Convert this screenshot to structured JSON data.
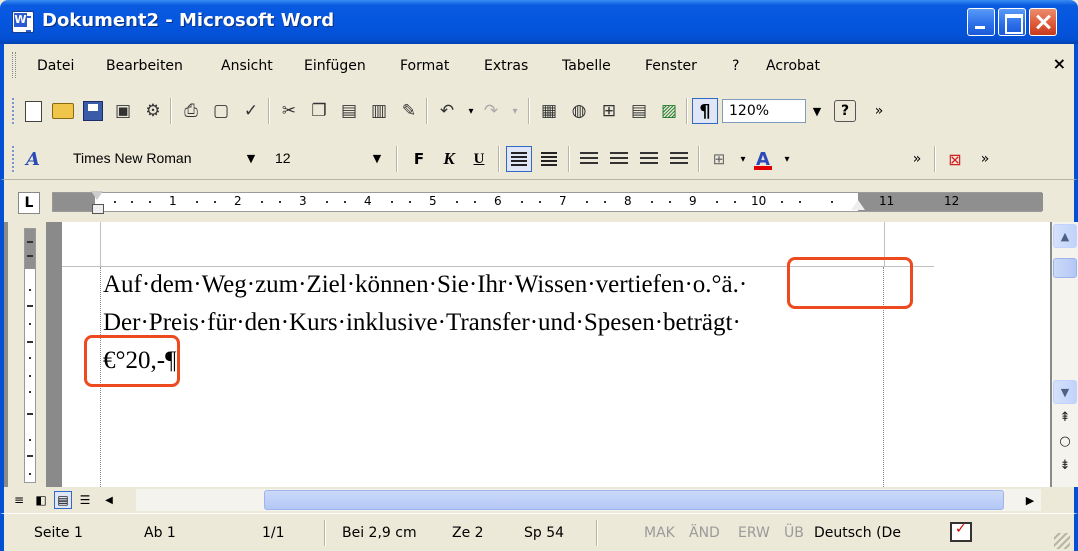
{
  "window": {
    "title": "Dokument2 - Microsoft Word",
    "icon": "word-icon"
  },
  "menu": {
    "items": [
      "Datei",
      "Bearbeiten",
      "Ansicht",
      "Einfügen",
      "Format",
      "Extras",
      "Tabelle",
      "Fenster",
      "?",
      "Acrobat"
    ],
    "close_glyph": "×"
  },
  "standard_toolbar": {
    "zoom": "120%",
    "icons": [
      "new-document-icon",
      "open-folder-icon",
      "save-icon",
      "permission-icon",
      "research-icon",
      "print-icon",
      "print-preview-icon",
      "spelling-icon",
      "cut-icon",
      "copy-icon",
      "paste-icon",
      "paste-options-icon",
      "format-painter-icon",
      "undo-icon",
      "redo-icon",
      "insert-picture-icon",
      "hyperlink-icon",
      "tables-borders-icon",
      "insert-table-icon",
      "insert-excel-icon",
      "show-formatting-icon",
      "help-icon"
    ],
    "show_formatting_glyph": "¶",
    "help_glyph": "?"
  },
  "formatting_toolbar": {
    "style_icon": "styles-icon",
    "font_name": "Times New Roman",
    "font_size": "12",
    "bold_label": "F",
    "italic_label": "K",
    "underline_label": "U",
    "font_color": "#e00000"
  },
  "ruler": {
    "tab_selector": "L",
    "numbers": [
      "1",
      "2",
      "3",
      "4",
      "5",
      "6",
      "7",
      "8",
      "9",
      "10",
      "11",
      "12"
    ]
  },
  "document": {
    "lines": [
      "Auf·dem·Weg·zum·Ziel·können·Sie·Ihr·Wissen·vertiefen·o.°ä.·",
      "Der·Preis·für·den·Kurs·inklusive·Transfer·und·Spesen·beträgt·",
      "€°20,-¶"
    ],
    "highlight_color": "#ee4a20"
  },
  "statusbar": {
    "page": "Seite 1",
    "section": "Ab 1",
    "page_of": "1/1",
    "position": "Bei 2,9 cm",
    "line": "Ze 2",
    "column": "Sp 54",
    "mak": "MAK",
    "aend": "ÄND",
    "erw": "ERW",
    "ueb": "ÜB",
    "language": "Deutsch (De"
  },
  "colors": {
    "titlebar": "#0556df",
    "chrome": "#ece9d8",
    "workspace": "#8a8a8a"
  }
}
